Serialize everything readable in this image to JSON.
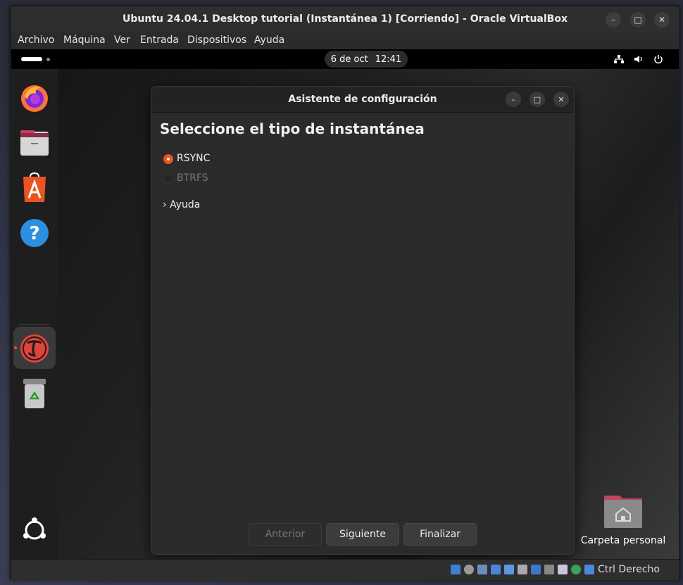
{
  "window": {
    "title": "Ubuntu 24.04.1 Desktop tutorial (Instantánea 1) [Corriendo] - Oracle VirtualBox",
    "controls": {
      "minimize": "–",
      "maximize": "□",
      "close": "✕"
    }
  },
  "menubar": {
    "items": [
      "Archivo",
      "Máquina",
      "Ver",
      "Entrada",
      "Dispositivos",
      "Ayuda"
    ]
  },
  "topbar": {
    "date": "6 de oct",
    "time": "12:41"
  },
  "dock": {
    "apps": [
      "firefox-icon",
      "files-icon",
      "app-center-icon",
      "help-icon",
      "timeshift-icon",
      "trash-icon"
    ],
    "show_apps": "show-apps-icon"
  },
  "dialog": {
    "title": "Asistente de configuración",
    "heading": "Seleccione el tipo de instantánea",
    "options": [
      {
        "label": "RSYNC",
        "selected": true
      },
      {
        "label": "BTRFS",
        "selected": false
      }
    ],
    "expander_arrow": "›",
    "expander_label": "Ayuda",
    "buttons": {
      "back": "Anterior",
      "next": "Siguiente",
      "finish": "Finalizar"
    }
  },
  "desktop": {
    "home_folder_label": "Carpeta personal"
  },
  "statusbar": {
    "host_key": "Ctrl Derecho"
  },
  "colors": {
    "accent": "#e95420"
  }
}
